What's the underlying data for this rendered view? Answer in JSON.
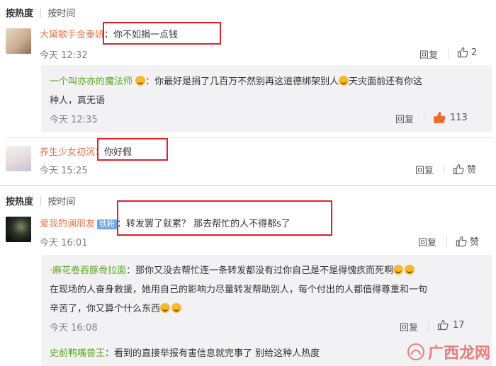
{
  "sort_bar_1": {
    "hot": "按热度",
    "time": "按时间"
  },
  "sort_bar_2": {
    "hot": "按热度",
    "time": "按时间"
  },
  "comments": [
    {
      "username": "大黛歌手金泰妍",
      "text": "：你不如捐一点钱",
      "time": "今天 12:32",
      "reply": "回复",
      "likes": "2",
      "sub": {
        "username": "一个叫亦亦的魔法师",
        "text1": "：你最好是捐了几百万不然别再这道德绑架别人",
        "text1b": "天灾面前还有你这",
        "text2": "种人，真无语",
        "time": "今天 12:35",
        "reply": "回复",
        "likes": "113"
      }
    },
    {
      "username": "养生少女初沉",
      "text": "：你好假",
      "time": "今天 15:25",
      "reply": "回复",
      "likes": "赞"
    },
    {
      "username": "爱我的澜朋友",
      "badge": "铁粉",
      "text": "：转发罢了就累？ 那去帮忙的人不得都s了",
      "time": "今天 16:01",
      "reply": "回复",
      "likes": "赞",
      "sub": {
        "username": "·麻花卷吞豚骨拉面",
        "text1": "：那你又没去帮忙连一条转发都没有过你自己是不是得愧疚而死啊",
        "text2": "在现场的人奋身救援，她用自己的影响力尽量转发帮助别人，每个付出的人都值得尊重和一句",
        "text3": "辛苦了，你又算个什么东西",
        "time": "今天 16:08",
        "reply": "回复",
        "likes": "17"
      },
      "sub2": {
        "username": "史前鸭嘴兽王",
        "text1": "：看到的直接举报有害信息就完事了 别给这种人热度"
      }
    }
  ],
  "watermark": "广西龙网",
  "colors": {
    "username": "#eb7350",
    "sub_username": "#5ba71f",
    "highlight_box": "#e0202a",
    "liked_thumb": "#f06a2a"
  }
}
